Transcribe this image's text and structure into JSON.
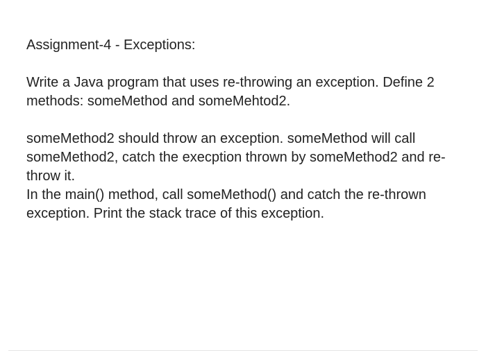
{
  "title": "Assignment-4 - Exceptions:",
  "paragraphs": [
    "Write a Java program that uses re-throwing an exception. Define 2 methods: someMethod and someMehtod2.",
    "someMethod2 should throw an exception. someMethod will call someMethod2, catch the execption thrown by someMethod2 and re-throw it.\nIn the main() method, call someMethod() and catch the re-thrown exception. Print the stack trace of this exception."
  ]
}
